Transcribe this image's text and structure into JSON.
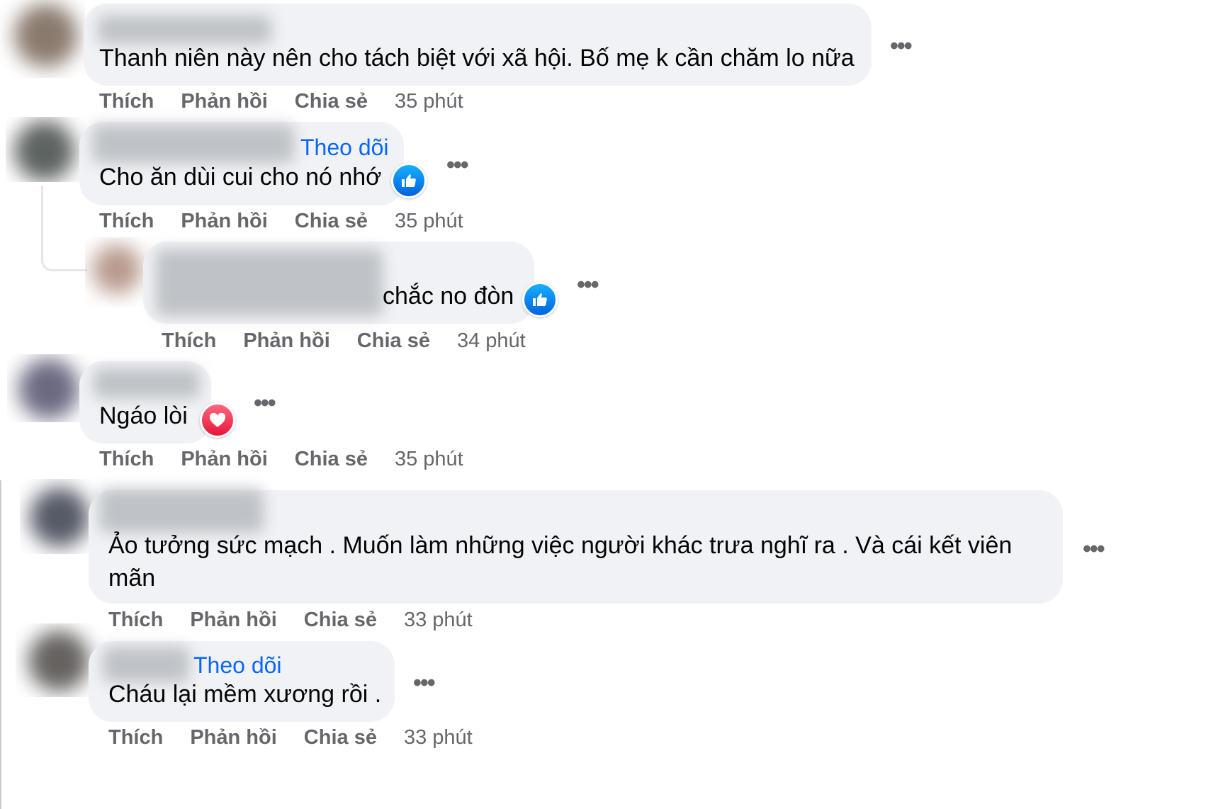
{
  "comments": [
    {
      "text": "Thanh niên này nên cho tách biệt với xã hội. Bố mẹ k cần chăm lo nữa",
      "actions": {
        "like": "Thích",
        "reply": "Phản hồi",
        "share": "Chia sẻ",
        "time": "35 phút"
      }
    },
    {
      "follow": "Theo dõi",
      "text": "Cho ăn dùi cui cho nó nhớ",
      "reaction": "like",
      "actions": {
        "like": "Thích",
        "reply": "Phản hồi",
        "share": "Chia sẻ",
        "time": "35 phút"
      }
    },
    {
      "text": "chắc no đòn",
      "reaction": "like",
      "actions": {
        "like": "Thích",
        "reply": "Phản hồi",
        "share": "Chia sẻ",
        "time": "34 phút"
      }
    },
    {
      "text": "Ngáo lòi",
      "reaction": "love",
      "actions": {
        "like": "Thích",
        "reply": "Phản hồi",
        "share": "Chia sẻ",
        "time": "35 phút"
      }
    },
    {
      "text_line1": "Ảo tưởng sức mạch . Muốn làm những việc người khác trưa nghĩ ra . Và cái kết viên",
      "text_line2": "mãn",
      "actions": {
        "like": "Thích",
        "reply": "Phản hồi",
        "share": "Chia sẻ",
        "time": "33 phút"
      }
    },
    {
      "follow": "Theo dõi",
      "text": "Cháu lại mềm xương rồi .",
      "actions": {
        "like": "Thích",
        "reply": "Phản hồi",
        "share": "Chia sẻ",
        "time": "33 phút"
      }
    }
  ],
  "more_icon": "•••",
  "colors": {
    "bubble": "#f0f2f5",
    "secondary_text": "#65676b",
    "link": "#0866ff",
    "like": "#0866ff",
    "love": "#f33e58"
  }
}
